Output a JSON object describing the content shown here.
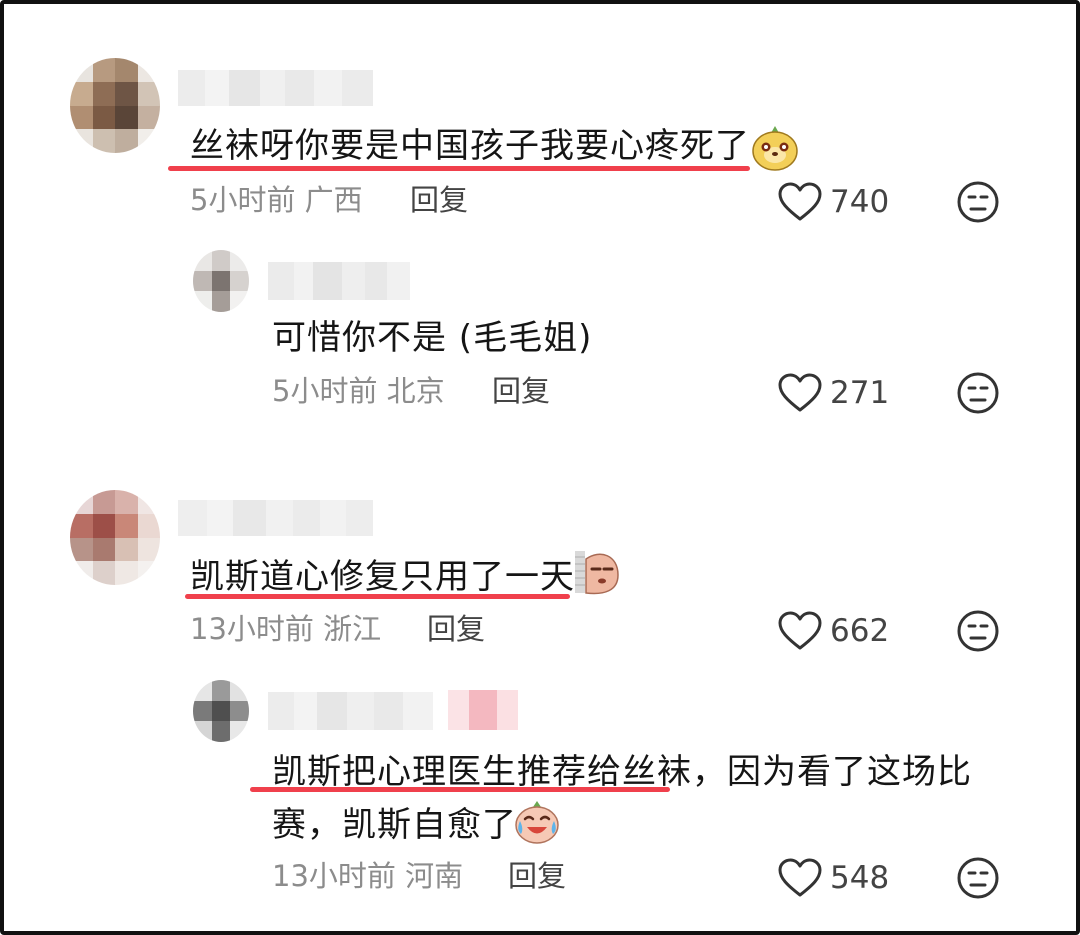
{
  "comments": [
    {
      "text": "丝袜呀你要是中国孩子我要心疼死了",
      "time": "5小时前",
      "location": "广西",
      "reply_label": "回复",
      "likes": "740",
      "emoji": "meerkat-emoji",
      "replies": [
        {
          "text": "可惜你不是 (毛毛姐)",
          "time": "5小时前",
          "location": "北京",
          "reply_label": "回复",
          "likes": "271"
        }
      ]
    },
    {
      "text": "凯斯道心修复只用了一天",
      "time": "13小时前",
      "location": "浙江",
      "reply_label": "回复",
      "likes": "662",
      "emoji": "peeking-emoji",
      "replies": [
        {
          "text_line1": "凯斯把心理医生推荐给丝袜，因为看了这场比",
          "text_line2": "赛，凯斯自愈了",
          "time": "13小时前",
          "location": "河南",
          "reply_label": "回复",
          "likes": "548",
          "emoji": "crying-laughing-emoji"
        }
      ]
    }
  ],
  "icons": {
    "like": "heart-outline-icon",
    "dislike": "neutral-face-icon"
  },
  "colors": {
    "underline": "#f0404c",
    "meta_text": "#8c8c8c"
  }
}
